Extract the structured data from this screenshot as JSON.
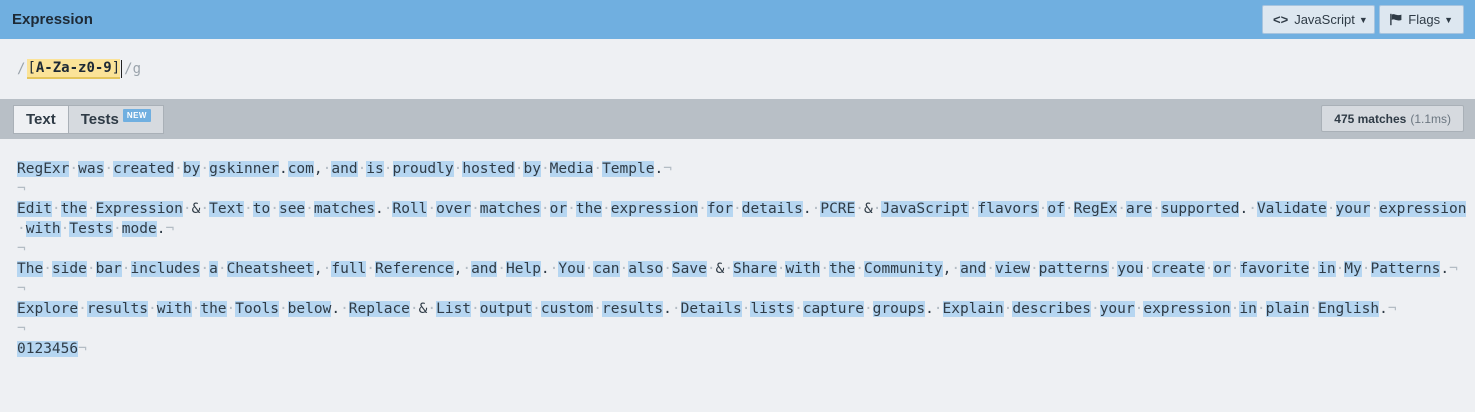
{
  "header": {
    "title": "Expression",
    "flavor_label": "JavaScript",
    "flags_label": "Flags"
  },
  "expression": {
    "open_delim": "/",
    "open_bracket": "[",
    "pattern": "A-Za-z0-9",
    "close_bracket": "]",
    "close_delim": "/",
    "flags": "g"
  },
  "tabs": [
    {
      "label": "Text"
    },
    {
      "label": "Tests",
      "badge": "NEW"
    }
  ],
  "status": {
    "matches": "475 matches",
    "time": "(1.1ms)"
  },
  "text": {
    "lines": [
      "RegExr was created by gskinner.com, and is proudly hosted by Media Temple.",
      "",
      "Edit the Expression & Text to see matches. Roll over matches or the expression for details. PCRE & JavaScript flavors of RegEx are supported. Validate your expression with Tests mode.",
      "",
      "The side bar includes a Cheatsheet, full Reference, and Help. You can also Save & Share with the Community, and view patterns you create or favorite in My Patterns.",
      "",
      "Explore results with the Tools below. Replace & List output custom results. Details lists capture groups. Explain describes your expression in plain English.",
      "",
      "0123456"
    ]
  },
  "colors": {
    "header_bg": "#70afe0",
    "match_highlight": "#b6d6f1",
    "expression_highlight": "#fbe398"
  }
}
